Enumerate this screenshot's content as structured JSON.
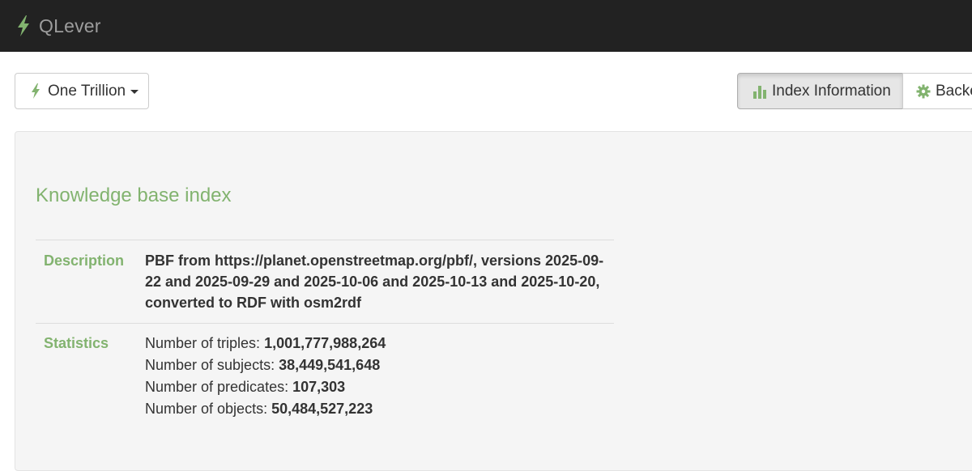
{
  "navbar": {
    "brand": "QLever",
    "brand_icon": "bolt-icon",
    "background": "#222222"
  },
  "toolbar": {
    "backend_label": "One Trillion",
    "index_info_label": "Index Information",
    "backend_button2_label": "Backe"
  },
  "colors": {
    "accent": "#82b36f",
    "text": "#333333",
    "panel": "#f5f5f5"
  },
  "knowledge_base": {
    "title": "Knowledge base index",
    "description_label": "Description",
    "description": "PBF from https://planet.openstreetmap.org/pbf/, versions 2025-09-22 and 2025-09-29 and 2025-10-06 and 2025-10-13 and 2025-10-20, converted to RDF with osm2rdf",
    "statistics_label": "Statistics",
    "statistics": [
      {
        "label": "Number of triples:",
        "value": "1,001,777,988,264"
      },
      {
        "label": "Number of subjects:",
        "value": "38,449,541,648"
      },
      {
        "label": "Number of predicates:",
        "value": "107,303"
      },
      {
        "label": "Number of objects:",
        "value": "50,484,527,223"
      }
    ]
  }
}
